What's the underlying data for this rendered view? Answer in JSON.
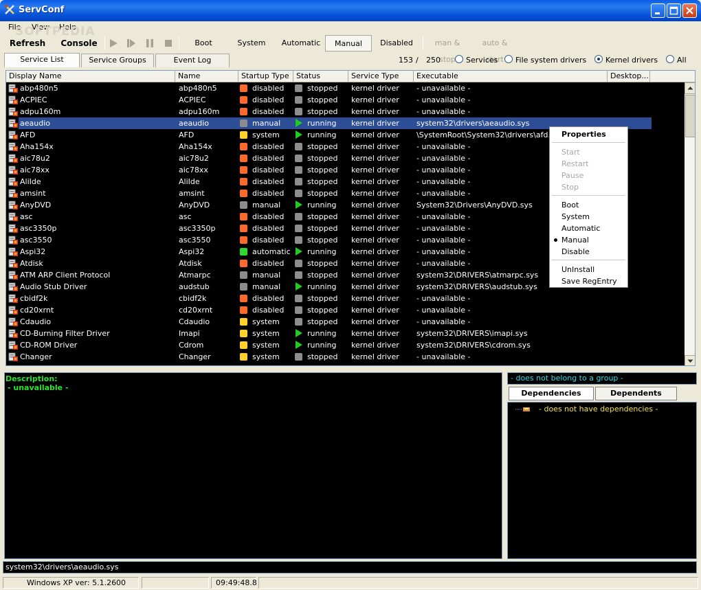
{
  "window": {
    "title": "ServConf"
  },
  "watermark": "SOFTPEDIA",
  "menu": [
    "File",
    "View",
    "Help"
  ],
  "toolbar": {
    "refresh": "Refresh",
    "console": "Console",
    "boot": "Boot",
    "system": "System",
    "automatic": "Automatic",
    "manual": "Manual",
    "disabled": "Disabled",
    "man_stop": "man & stop",
    "auto_start": "auto & start"
  },
  "tabs": [
    "Service List",
    "Service Groups",
    "Event Log"
  ],
  "counter": {
    "shown": "153",
    "sep": "/",
    "total": "250"
  },
  "filters": [
    "Services",
    "File system drivers",
    "Kernel drivers",
    "All"
  ],
  "filter_selected": "Kernel drivers",
  "columns": [
    "Display Name",
    "Name",
    "Startup Type",
    "Status",
    "Service Type",
    "Executable",
    "Desktop..."
  ],
  "rows": [
    {
      "display": "abp480n5",
      "name": "abp480n5",
      "startup": "disabled",
      "status": "stopped",
      "type": "kernel driver",
      "exe": " - unavailable -"
    },
    {
      "display": "ACPIEC",
      "name": "ACPIEC",
      "startup": "disabled",
      "status": "stopped",
      "type": "kernel driver",
      "exe": " - unavailable -"
    },
    {
      "display": "adpu160m",
      "name": "adpu160m",
      "startup": "disabled",
      "status": "stopped",
      "type": "kernel driver",
      "exe": " - unavailable -"
    },
    {
      "display": "aeaudio",
      "name": "aeaudio",
      "startup": "manual",
      "status": "running",
      "type": "kernel driver",
      "exe": "system32\\drivers\\aeaudio.sys",
      "selected": true
    },
    {
      "display": "AFD",
      "name": "AFD",
      "startup": "system",
      "status": "running",
      "type": "kernel driver",
      "exe": "\\SystemRoot\\System32\\drivers\\afd.sys"
    },
    {
      "display": "Aha154x",
      "name": "Aha154x",
      "startup": "disabled",
      "status": "stopped",
      "type": "kernel driver",
      "exe": " - unavailable -"
    },
    {
      "display": "aic78u2",
      "name": "aic78u2",
      "startup": "disabled",
      "status": "stopped",
      "type": "kernel driver",
      "exe": " - unavailable -"
    },
    {
      "display": "aic78xx",
      "name": "aic78xx",
      "startup": "disabled",
      "status": "stopped",
      "type": "kernel driver",
      "exe": " - unavailable -"
    },
    {
      "display": "AliIde",
      "name": "AliIde",
      "startup": "disabled",
      "status": "stopped",
      "type": "kernel driver",
      "exe": " - unavailable -"
    },
    {
      "display": "amsint",
      "name": "amsint",
      "startup": "disabled",
      "status": "stopped",
      "type": "kernel driver",
      "exe": " - unavailable -"
    },
    {
      "display": "AnyDVD",
      "name": "AnyDVD",
      "startup": "manual",
      "status": "running",
      "type": "kernel driver",
      "exe": "System32\\Drivers\\AnyDVD.sys"
    },
    {
      "display": "asc",
      "name": "asc",
      "startup": "disabled",
      "status": "stopped",
      "type": "kernel driver",
      "exe": " - unavailable -"
    },
    {
      "display": "asc3350p",
      "name": "asc3350p",
      "startup": "disabled",
      "status": "stopped",
      "type": "kernel driver",
      "exe": " - unavailable -"
    },
    {
      "display": "asc3550",
      "name": "asc3550",
      "startup": "disabled",
      "status": "stopped",
      "type": "kernel driver",
      "exe": " - unavailable -"
    },
    {
      "display": "Aspi32",
      "name": "Aspi32",
      "startup": "automatic",
      "status": "running",
      "type": "kernel driver",
      "exe": " - unavailable -"
    },
    {
      "display": "Atdisk",
      "name": "Atdisk",
      "startup": "disabled",
      "status": "stopped",
      "type": "kernel driver",
      "exe": " - unavailable -"
    },
    {
      "display": "ATM ARP Client Protocol",
      "name": "Atmarpc",
      "startup": "manual",
      "status": "stopped",
      "type": "kernel driver",
      "exe": "system32\\DRIVERS\\atmarpc.sys"
    },
    {
      "display": "Audio Stub Driver",
      "name": "audstub",
      "startup": "manual",
      "status": "running",
      "type": "kernel driver",
      "exe": "system32\\DRIVERS\\audstub.sys"
    },
    {
      "display": "cbidf2k",
      "name": "cbidf2k",
      "startup": "disabled",
      "status": "stopped",
      "type": "kernel driver",
      "exe": " - unavailable -"
    },
    {
      "display": "cd20xrnt",
      "name": "cd20xrnt",
      "startup": "disabled",
      "status": "stopped",
      "type": "kernel driver",
      "exe": " - unavailable -"
    },
    {
      "display": "Cdaudio",
      "name": "Cdaudio",
      "startup": "system",
      "status": "stopped",
      "type": "kernel driver",
      "exe": " - unavailable -"
    },
    {
      "display": "CD-Burning Filter Driver",
      "name": "Imapi",
      "startup": "system",
      "status": "running",
      "type": "kernel driver",
      "exe": "system32\\DRIVERS\\imapi.sys"
    },
    {
      "display": "CD-ROM Driver",
      "name": "Cdrom",
      "startup": "system",
      "status": "running",
      "type": "kernel driver",
      "exe": "system32\\DRIVERS\\cdrom.sys"
    },
    {
      "display": "Changer",
      "name": "Changer",
      "startup": "system",
      "status": "stopped",
      "type": "kernel driver",
      "exe": " - unavailable -"
    }
  ],
  "startup_colors": {
    "disabled": "#ff6a2a",
    "manual": "#8c8c8c",
    "system": "#ffd22a",
    "automatic": "#2ed82e"
  },
  "context_menu": {
    "properties": "Properties",
    "start": "Start",
    "restart": "Restart",
    "pause": "Pause",
    "stop": "Stop",
    "boot": "Boot",
    "system": "System",
    "automatic": "Automatic",
    "manual": "Manual",
    "disable": "Disable",
    "uninstall": "UnInstall",
    "save": "Save RegEntry",
    "checked": "Manual"
  },
  "description": {
    "title": "Description:",
    "text": " - unavailable -"
  },
  "group": " - does not belong to a group -",
  "dep_tabs": [
    "Dependencies",
    "Dependents"
  ],
  "dependencies_text": "- does not have dependencies -",
  "path": "system32\\drivers\\aeaudio.sys",
  "status": {
    "os": "Windows XP ver: 5.1.2600",
    "time": "09:49:48.8"
  }
}
